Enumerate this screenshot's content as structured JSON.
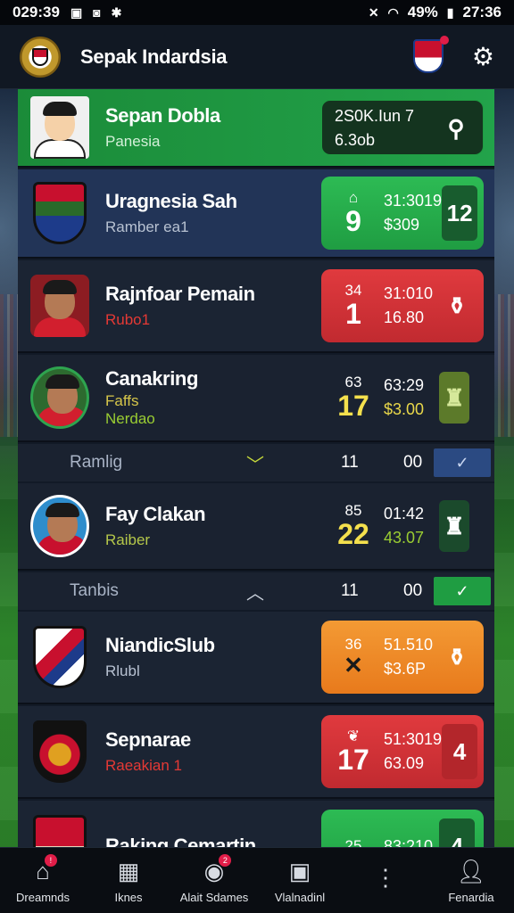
{
  "status_bar": {
    "time_left": "029:39",
    "battery": "49%",
    "time_right": "27:36"
  },
  "app": {
    "title": "Sepak Indardsia"
  },
  "rows": [
    {
      "name": "Sepan Dobla",
      "sub": "Panesia",
      "score_top": "2S0K.Iun 7",
      "score_bottom": "6.3ob"
    },
    {
      "name": "Uragnesia Sah",
      "sub": "Ramber ea1",
      "s_top": "",
      "s_big": "9",
      "m_top": "31:3019",
      "m_bottom": "$309",
      "ico": "12"
    },
    {
      "name": "Rajnfoar Pemain",
      "sub": "Rubo1",
      "s_top": "34",
      "s_big": "1",
      "m_top": "31:010",
      "m_bottom": "16.80"
    },
    {
      "name": "Canakring",
      "sub": "Faffs",
      "sub2": "Nerdao",
      "s_top": "63",
      "s_big": "17",
      "m_top": "63:29",
      "m_bottom": "$3.00"
    },
    {
      "name": "Fay Clakan",
      "sub": "Raiber",
      "s_top": "85",
      "s_big": "22",
      "m_top": "01:42",
      "m_bottom": "43.07"
    },
    {
      "name": "NiandicSlub",
      "sub": "Rlubl",
      "s_top": "36",
      "s_big": "",
      "m_top": "51.510",
      "m_bottom": "$3.6P"
    },
    {
      "name": "Sepnarae",
      "sub": "Raeakian 1",
      "s_top": "",
      "s_big": "17",
      "m_top": "51:3019",
      "m_bottom": "63.09",
      "ico": "4"
    },
    {
      "name": "Raking Cemartin",
      "sub": "",
      "s_top": "25",
      "s_big": "",
      "m_top": "83:210",
      "m_bottom": "",
      "ico": "4"
    }
  ],
  "fixtures": [
    {
      "label": "Ramlig",
      "a": "11",
      "b": "00"
    },
    {
      "label": "Tanbis",
      "a": "11",
      "b": "00"
    }
  ],
  "nav": [
    {
      "label": "Dreamnds",
      "icon": "home-icon"
    },
    {
      "label": "Iknes",
      "icon": "calendar-icon"
    },
    {
      "label": "Alait Sdames",
      "icon": "ball-icon"
    },
    {
      "label": "Vlalnadinl",
      "icon": "profile-card-icon"
    },
    {
      "label": "",
      "icon": "more-icon"
    },
    {
      "label": "Fenardia",
      "icon": "user-icon"
    }
  ],
  "colors": {
    "green": "#22a34a",
    "red": "#e03a3e",
    "orange": "#f39a34",
    "blue": "#223457"
  }
}
